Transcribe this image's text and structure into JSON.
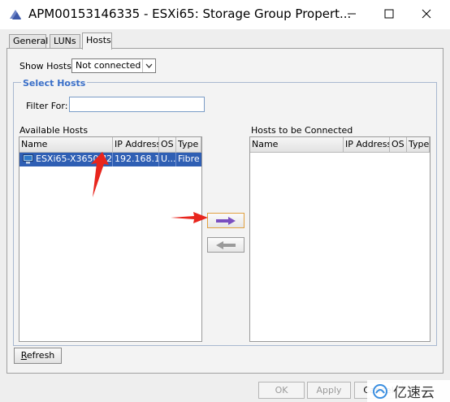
{
  "window": {
    "title": "APM00153146335 - ESXi65: Storage Group Propert...",
    "minimize_icon": "minimize-icon",
    "maximize_icon": "maximize-icon",
    "close_icon": "close-icon"
  },
  "tabs": [
    {
      "label": "General",
      "selected": false
    },
    {
      "label": "LUNs",
      "selected": false
    },
    {
      "label": "Hosts",
      "selected": true
    }
  ],
  "show_hosts": {
    "label": "Show Hosts:",
    "value": "Not connected"
  },
  "select_hosts": {
    "title": "Select Hosts",
    "filter_label": "Filter For:",
    "filter_value": ""
  },
  "available_hosts": {
    "label": "Available Hosts",
    "columns": [
      "Name",
      "IP Address",
      "OS",
      "Type"
    ],
    "rows": [
      {
        "name": "ESXi65-X3650M2",
        "ip": "192.168.1...",
        "os": "U...",
        "type": "Fibre",
        "selected": true
      }
    ]
  },
  "connected_hosts": {
    "label": "Hosts to be Connected",
    "columns": [
      "Name",
      "IP Address",
      "OS",
      "Type"
    ],
    "rows": []
  },
  "buttons": {
    "add_icon": "right-arrow-icon",
    "remove_icon": "left-arrow-icon",
    "refresh_underline": "R",
    "refresh_rest": "efresh",
    "ok": "OK",
    "apply": "Apply",
    "cancel": "Cancel"
  },
  "watermark": {
    "text": "亿速云"
  },
  "colors": {
    "selection": "#2f5fb4",
    "group_title": "#3a6fc8",
    "annotation": "#e8251d",
    "add_arrow": "#7a4fc0"
  }
}
